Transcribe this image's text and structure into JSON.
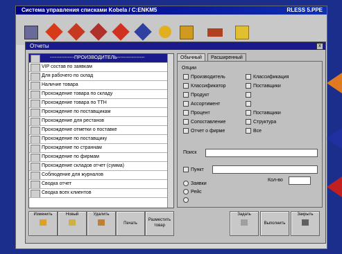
{
  "app": {
    "title": "Система управления списками Kobela / C:ENKM5",
    "title_right": "RLESS 5.PPE"
  },
  "toolbar": {
    "icons": [
      "logo-icon",
      "diamond-red-icon",
      "diamond-red-icon",
      "diamond-red-icon",
      "diamond-red-icon",
      "diamond-blue-icon",
      "sun-icon",
      "folder-icon",
      "box-icon",
      "chart-icon"
    ]
  },
  "dialog": {
    "title": "Отчеты",
    "close": "x",
    "list": [
      "---------------ПРОИЗВОДИТЕЛЬ-----------------",
      "VIP состав по заявкам",
      "Для рабочего по склад",
      "Наличие товара",
      "Прохождение товара по складу",
      "Прохождение товара по ТТН",
      "Прохождение по поставщикам",
      "Прохождение для рестанов",
      "Прохождение отметки о поставке",
      "Прохождение по поставщику",
      "Прохождение по страннам",
      "Прохождение по фирмам",
      "Прохождение складов отчет (сумма)",
      "Соблюдение для журналов",
      "Сводка отчет",
      "Сводка всех клиентов"
    ],
    "tabs": [
      "Обычный",
      "Расширенный"
    ],
    "panel": {
      "group_label": "Опции",
      "left_options": [
        "Производитель",
        "Классификатор",
        "Продукт",
        "Ассортимент",
        "Процент",
        "Сопоставление",
        "Отчет о фирме"
      ],
      "right_options": [
        "Классификация",
        "Поставщики",
        "",
        "",
        "Поставщики",
        "Структура",
        "Все"
      ],
      "field1_label": "Поиск",
      "field2_label": "Пункт",
      "qty_label": "Кол-во",
      "radios": [
        "Заявки",
        "Рейс",
        ""
      ]
    },
    "buttons": {
      "left": [
        "Изменить",
        "Новый",
        "Удалить",
        "Печать",
        "Разместить товар"
      ],
      "right": [
        "Задать",
        "Выполнить",
        "Закрыть"
      ]
    }
  }
}
